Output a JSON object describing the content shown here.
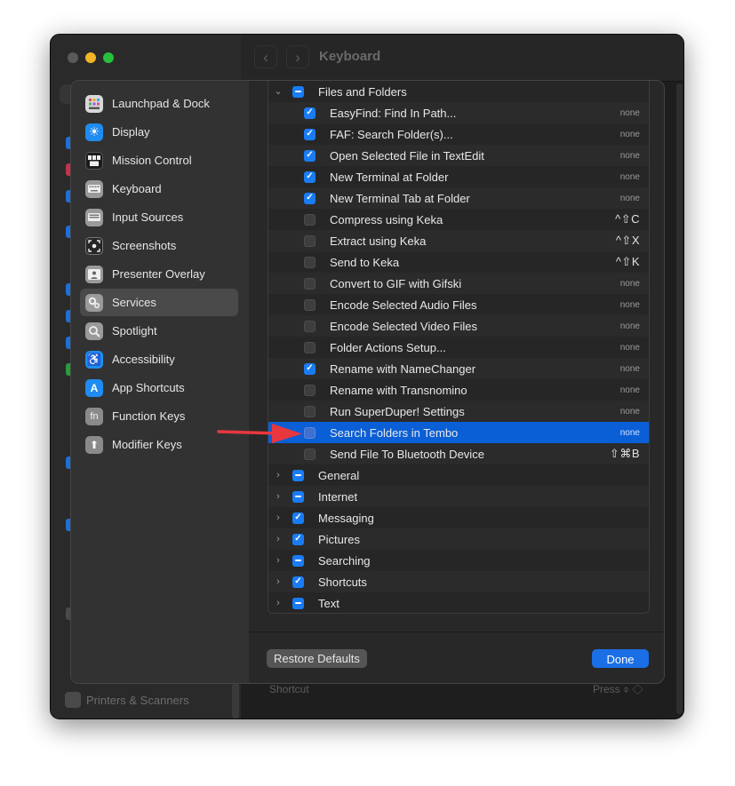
{
  "window": {
    "title": "Keyboard",
    "back_glyph": "‹",
    "forward_glyph": "›",
    "bottom_sidebar_item": "Printers & Scanners",
    "bottom_shortcut_label": "Shortcut",
    "bottom_press_label": "Press ⌽ ◇"
  },
  "sidebar": {
    "items": [
      {
        "label": "Launchpad & Dock",
        "icon": "launchpad-icon",
        "color": "#d8d8d8"
      },
      {
        "label": "Display",
        "icon": "sun-icon",
        "color": "#1e8cf0"
      },
      {
        "label": "Mission Control",
        "icon": "mission-control-icon",
        "color": "#1c1c1c"
      },
      {
        "label": "Keyboard",
        "icon": "keyboard-icon",
        "color": "#9a9a9a"
      },
      {
        "label": "Input Sources",
        "icon": "input-sources-icon",
        "color": "#9a9a9a"
      },
      {
        "label": "Screenshots",
        "icon": "screenshot-icon",
        "color": "#262626"
      },
      {
        "label": "Presenter Overlay",
        "icon": "presenter-icon",
        "color": "#9a9a9a"
      },
      {
        "label": "Services",
        "icon": "gears-icon",
        "color": "#9a9a9a"
      },
      {
        "label": "Spotlight",
        "icon": "magnifier-icon",
        "color": "#9a9a9a"
      },
      {
        "label": "Accessibility",
        "icon": "accessibility-icon",
        "color": "#1e8cf0"
      },
      {
        "label": "App Shortcuts",
        "icon": "app-store-icon",
        "color": "#1e8cf0"
      },
      {
        "label": "Function Keys",
        "icon": "fn-key-icon",
        "color": "#8a8a8a"
      },
      {
        "label": "Modifier Keys",
        "icon": "arrow-up-icon",
        "color": "#8a8a8a"
      }
    ],
    "selected": "Services",
    "fn_glyph": "fn",
    "accessibility_glyph": "♿",
    "app_shortcuts_glyph": "A",
    "modifier_glyph": "⬆",
    "display_glyph": "☀"
  },
  "services": {
    "group_open": {
      "label": "Files and Folders",
      "state": "mixed"
    },
    "items": [
      {
        "label": "EasyFind: Find In Path...",
        "checked": "on",
        "shortcut": "none"
      },
      {
        "label": "FAF: Search Folder(s)...",
        "checked": "on",
        "shortcut": "none"
      },
      {
        "label": "Open Selected File in TextEdit",
        "checked": "on",
        "shortcut": "none"
      },
      {
        "label": "New Terminal at Folder",
        "checked": "on",
        "shortcut": "none"
      },
      {
        "label": "New Terminal Tab at Folder",
        "checked": "on",
        "shortcut": "none"
      },
      {
        "label": "Compress using Keka",
        "checked": "off",
        "shortcut": "^⇧C"
      },
      {
        "label": "Extract using Keka",
        "checked": "off",
        "shortcut": "^⇧X"
      },
      {
        "label": "Send to Keka",
        "checked": "off",
        "shortcut": "^⇧K"
      },
      {
        "label": "Convert to GIF with Gifski",
        "checked": "off",
        "shortcut": "none"
      },
      {
        "label": "Encode Selected Audio Files",
        "checked": "off",
        "shortcut": "none"
      },
      {
        "label": "Encode Selected Video Files",
        "checked": "off",
        "shortcut": "none"
      },
      {
        "label": "Folder Actions Setup...",
        "checked": "off",
        "shortcut": "none"
      },
      {
        "label": "Rename with NameChanger",
        "checked": "on",
        "shortcut": "none"
      },
      {
        "label": "Rename with Transnomino",
        "checked": "off",
        "shortcut": "none"
      },
      {
        "label": "Run SuperDuper! Settings",
        "checked": "off",
        "shortcut": "none"
      },
      {
        "label": "Search Folders in Tembo",
        "checked": "off",
        "shortcut": "none",
        "selected": true
      },
      {
        "label": "Send File To Bluetooth Device",
        "checked": "off",
        "shortcut": "⇧⌘B"
      }
    ],
    "groups": [
      {
        "label": "General",
        "state": "mixed"
      },
      {
        "label": "Internet",
        "state": "mixed"
      },
      {
        "label": "Messaging",
        "state": "on"
      },
      {
        "label": "Pictures",
        "state": "on"
      },
      {
        "label": "Searching",
        "state": "mixed"
      },
      {
        "label": "Shortcuts",
        "state": "on"
      },
      {
        "label": "Text",
        "state": "mixed"
      }
    ],
    "chevron_open": "⌄",
    "chevron_closed": "›",
    "check_glyph": "✓"
  },
  "buttons": {
    "restore_defaults": "Restore Defaults",
    "done": "Done"
  },
  "colors": {
    "accent": "#1a7cf5",
    "selection": "#0b5fd6",
    "arrow": "#e8373f"
  }
}
